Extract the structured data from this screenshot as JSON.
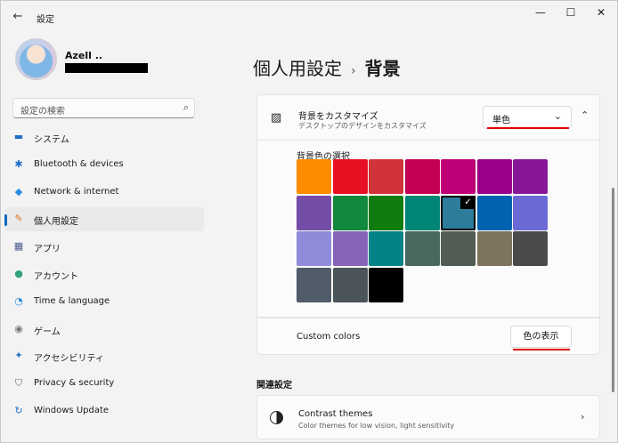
{
  "window": {
    "title": "設定",
    "back_glyph": "←",
    "minimize_glyph": "—",
    "maximize_glyph": "☐",
    "close_glyph": "✕"
  },
  "user": {
    "name": "Azell .."
  },
  "search": {
    "placeholder": "設定の検索",
    "icon": "⌕"
  },
  "nav": {
    "items": [
      {
        "label": "システム",
        "icon": "▬",
        "color": "#1f6fc5"
      },
      {
        "label": "Bluetooth & devices",
        "icon": "✱",
        "color": "#1f6fc5"
      },
      {
        "label": "Network & internet",
        "icon": "◆",
        "color": "#2a8be0"
      },
      {
        "label": "個人用設定",
        "icon": "✎",
        "color": "#d4762b"
      },
      {
        "label": "アプリ",
        "icon": "▦",
        "color": "#4b5d8f"
      },
      {
        "label": "アカウント",
        "icon": "●",
        "color": "#2fa37a"
      },
      {
        "label": "Time & language",
        "icon": "◔",
        "color": "#2a8be0"
      },
      {
        "label": "ゲーム",
        "icon": "◉",
        "color": "#777777"
      },
      {
        "label": "アクセシビリティ",
        "icon": "✦",
        "color": "#1f6fc5"
      },
      {
        "label": "Privacy & security",
        "icon": "⛉",
        "color": "#6b6b6b"
      },
      {
        "label": "Windows Update",
        "icon": "↻",
        "color": "#1f6fc5"
      }
    ],
    "active_index": 3
  },
  "page": {
    "parent": "個人用設定",
    "separator": "›",
    "current": "背景"
  },
  "background": {
    "title": "背景をカスタマイズ",
    "subtitle": "デスクトップのデザインをカスタマイズ",
    "icon": "▨",
    "dropdown_value": "単色",
    "dropdown_chev": "⌄",
    "collapse_chev": "⌃",
    "swatch_label": "背景色の選択",
    "check_glyph": "✓",
    "selected_swatch": 11,
    "swatches": [
      "#ff8c00",
      "#e81123",
      "#d13438",
      "#c30052",
      "#bf0077",
      "#9a0089",
      "#881798",
      "#744da9",
      "#10893e",
      "#107c10",
      "#018574",
      "#2d7d9a",
      "#0063b1",
      "#6b69d6",
      "#8e8cd8",
      "#8764b8",
      "#038387",
      "#486860",
      "#525e54",
      "#7e735f",
      "#4c4a48",
      "#515c6b",
      "#4a5459",
      "#000000"
    ],
    "custom_label": "Custom colors",
    "view_button": "色の表示",
    "accent_red": "#e00000"
  },
  "related": {
    "title": "関連設定",
    "contrast_title": "Contrast themes",
    "contrast_sub": "Color themes for low vision, light sensitivity",
    "chev": "›"
  }
}
